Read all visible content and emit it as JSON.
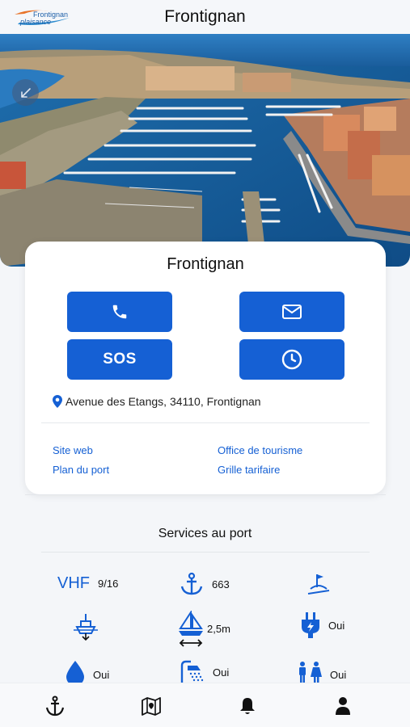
{
  "header": {
    "title": "Frontignan",
    "logo_top": "Frontignan",
    "logo_bottom": "plaisance"
  },
  "card": {
    "title": "Frontignan",
    "sos_label": "SOS",
    "address": "Avenue des Etangs, 34110, Frontignan",
    "links": {
      "site_web": "Site web",
      "office_tourisme": "Office de tourisme",
      "plan_port": "Plan du port",
      "grille_tarifaire": "Grille tarifaire"
    }
  },
  "services": {
    "title": "Services au port",
    "vhf_label": "VHF",
    "vhf_value": "9/16",
    "moorings_value": "663",
    "draft_value": "2,5m",
    "electricity_value": "Oui",
    "fuel_value": "Oui",
    "showers_value": "Oui",
    "toilets_value": "Oui"
  },
  "icons": {
    "phone": "phone-icon",
    "mail": "mail-icon",
    "clock": "clock-icon",
    "location": "location-pin-icon",
    "anchor": "anchor-icon",
    "slipway": "slipway-icon",
    "crane": "boat-lift-icon",
    "sailboat": "sailboat-draft-icon",
    "plug": "electric-plug-icon",
    "fuel": "fuel-drop-icon",
    "shower": "shower-icon",
    "toilets": "toilets-icon",
    "map": "map-icon",
    "bell": "bell-icon",
    "user": "user-icon"
  },
  "colors": {
    "accent": "#1560d4",
    "background": "#f4f6f9"
  }
}
